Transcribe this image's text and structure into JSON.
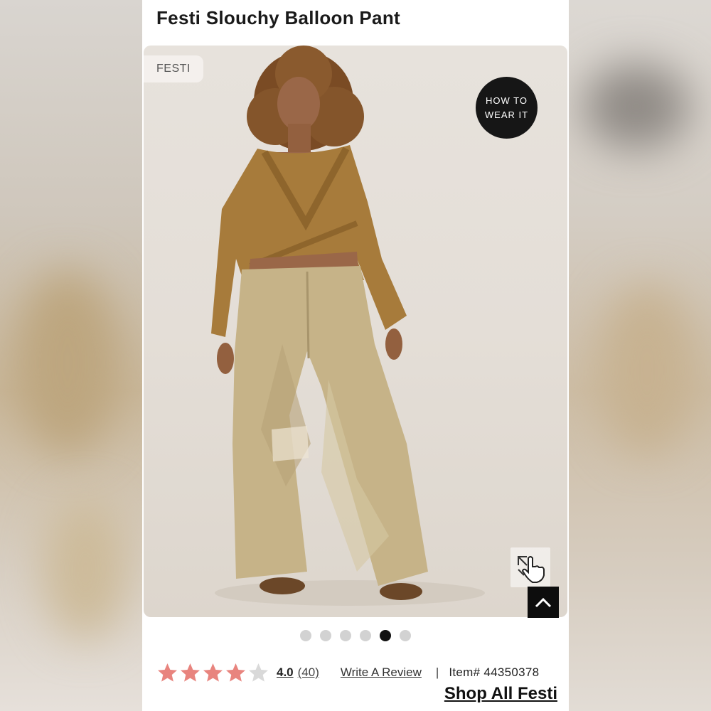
{
  "product": {
    "title": "Festi Slouchy Balloon Pant",
    "brand_tag": "FESTI",
    "how_to_wear": [
      "HOW TO",
      "WEAR IT"
    ]
  },
  "gallery": {
    "dots_total": 6,
    "active_index": 4,
    "zoom_icon": "expand-hand-icon",
    "back_to_top_icon": "chevron-up-icon"
  },
  "reviews": {
    "rating": "4.0",
    "stars_filled": 4,
    "stars_total": 5,
    "count": "(40)",
    "write_review": "Write A Review",
    "separator": "|",
    "item_label": "Item# 44350378"
  },
  "links": {
    "shop_all": "Shop All Festi"
  },
  "colors": {
    "star_filled": "#e8847e",
    "star_empty": "#d9d9d9",
    "sweater": "#a77b3b",
    "pants": "#c6b388"
  }
}
